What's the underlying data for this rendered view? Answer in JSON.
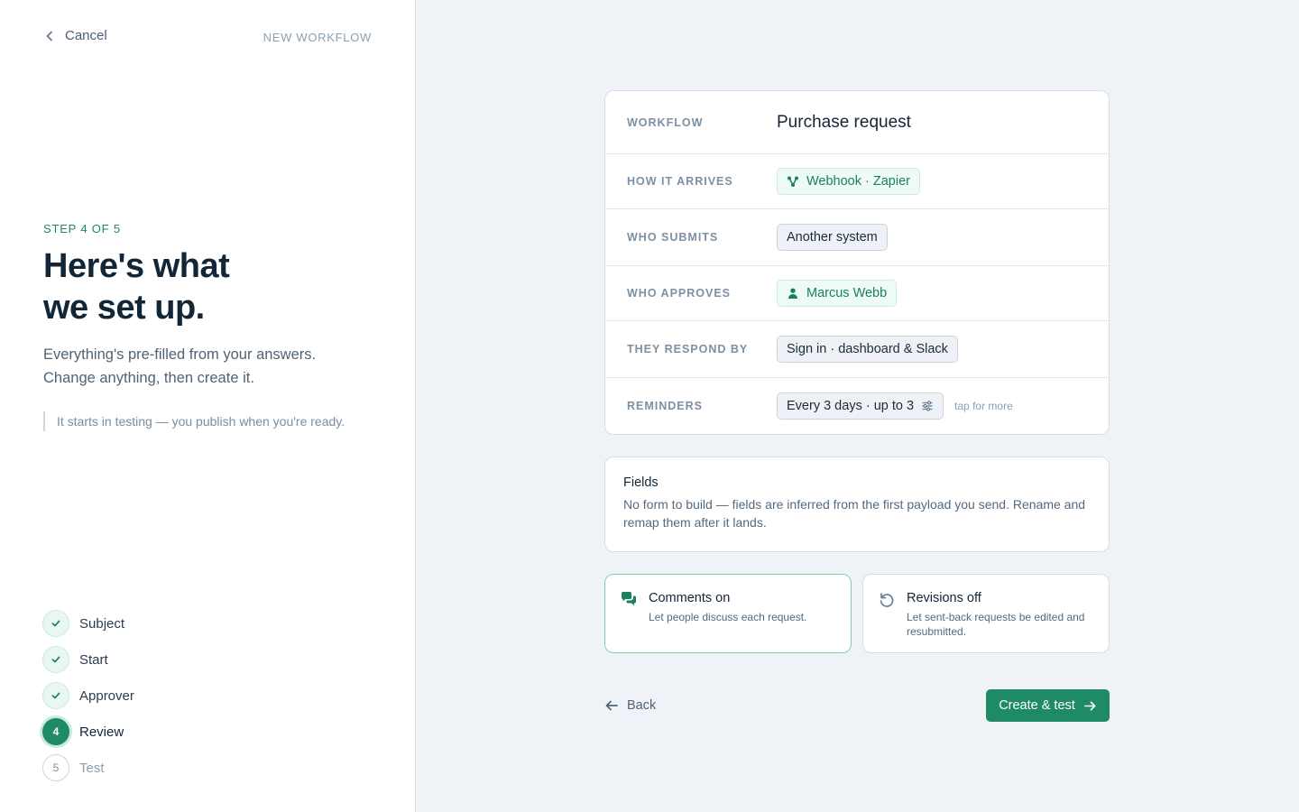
{
  "header": {
    "cancel_label": "Cancel",
    "eyebrow": "NEW WORKFLOW"
  },
  "intro": {
    "step_label": "STEP 4 OF 5",
    "headline": "Here's what\nwe set up.",
    "subtext": "Everything's pre-filled from your answers.\nChange anything, then create it.",
    "note": "It starts in testing — you publish when you're ready."
  },
  "steps": [
    {
      "number": "1",
      "label": "Subject",
      "state": "done"
    },
    {
      "number": "2",
      "label": "Start",
      "state": "done"
    },
    {
      "number": "3",
      "label": "Approver",
      "state": "done"
    },
    {
      "number": "4",
      "label": "Review",
      "state": "active"
    },
    {
      "number": "5",
      "label": "Test",
      "state": "todo"
    }
  ],
  "summary": {
    "workflow": {
      "label": "WORKFLOW",
      "value": "Purchase request"
    },
    "arrives": {
      "label": "HOW IT ARRIVES",
      "value": "Webhook · Zapier",
      "icon": "webhook-icon"
    },
    "submits": {
      "label": "WHO SUBMITS",
      "value": "Another system"
    },
    "approves": {
      "label": "WHO APPROVES",
      "value": "Marcus Webb",
      "icon": "person-icon"
    },
    "respond": {
      "label": "THEY RESPOND BY",
      "value": "Sign in · dashboard & Slack"
    },
    "reminders": {
      "label": "REMINDERS",
      "value": "Every 3 days · up to 3",
      "icon": "sliders-icon",
      "hint": "tap for more"
    }
  },
  "fields": {
    "title": "Fields",
    "description": "No form to build — fields are inferred from the first payload you send. Rename and remap them after it lands."
  },
  "toggles": {
    "comments": {
      "title": "Comments on",
      "description": "Let people discuss each request.",
      "icon": "comments-icon",
      "state": "on"
    },
    "revisions": {
      "title": "Revisions off",
      "description": "Let sent-back requests be edited and resubmitted.",
      "icon": "undo-icon",
      "state": "off"
    }
  },
  "actions": {
    "back_label": "Back",
    "primary_label": "Create & test"
  },
  "colors": {
    "accent": "#1f8a66",
    "accent_soft": "#eefaf4",
    "page_bg": "#eff3f8"
  }
}
